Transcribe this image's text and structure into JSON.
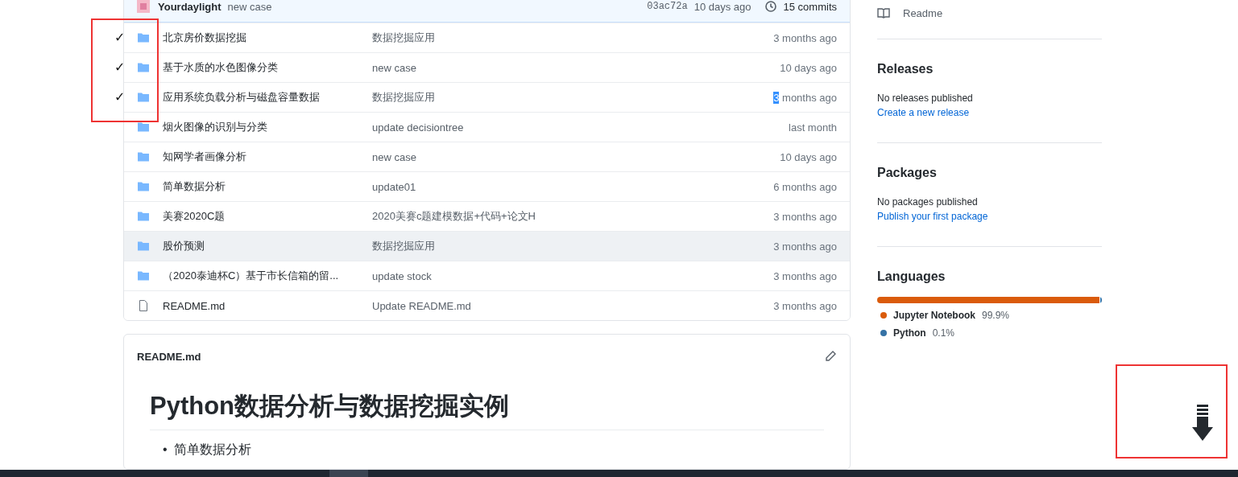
{
  "commit_bar": {
    "author": "Yourdaylight",
    "message": "new case",
    "sha": "03ac72a",
    "time": "10 days ago",
    "commits": "15 commits"
  },
  "files": [
    {
      "kind": "folder",
      "name": "北京房价数据挖掘",
      "message": "数据挖掘应用",
      "time": [
        {
          "text": "3 months ago",
          "selected": false
        }
      ],
      "mark": "✓",
      "hovered": false
    },
    {
      "kind": "folder",
      "name": "基于水质的水色图像分类",
      "message": "new case",
      "time": [
        {
          "text": "10 days ago",
          "selected": false
        }
      ],
      "mark": "✓",
      "hovered": false
    },
    {
      "kind": "folder",
      "name": "应用系统负载分析与磁盘容量数据",
      "message": "数据挖掘应用",
      "time": [
        {
          "text": "3",
          "selected": true
        },
        {
          "text": " months ago",
          "selected": false
        }
      ],
      "mark": "✓",
      "hovered": false
    },
    {
      "kind": "folder",
      "name": "烟火图像的识别与分类",
      "message": "update decisiontree",
      "time": [
        {
          "text": "last month",
          "selected": false
        }
      ],
      "hovered": false
    },
    {
      "kind": "folder",
      "name": "知网学者画像分析",
      "message": "new case",
      "time": [
        {
          "text": "10 days ago",
          "selected": false
        }
      ],
      "hovered": false
    },
    {
      "kind": "folder",
      "name": "简单数据分析",
      "message": "update01",
      "time": [
        {
          "text": "6 months ago",
          "selected": false
        }
      ],
      "hovered": false
    },
    {
      "kind": "folder",
      "name": "美赛2020C题",
      "message": "2020美赛c题建模数据+代码+论文H",
      "time": [
        {
          "text": "3 months ago",
          "selected": false
        }
      ],
      "hovered": false
    },
    {
      "kind": "folder",
      "name": "股价预测",
      "message": "数据挖掘应用",
      "time": [
        {
          "text": "3 months ago",
          "selected": false
        }
      ],
      "hovered": true
    },
    {
      "kind": "folder",
      "name": "（2020泰迪杯C）基于市长信箱的留...",
      "message": "update stock",
      "time": [
        {
          "text": "3 months ago",
          "selected": false
        }
      ],
      "hovered": false
    },
    {
      "kind": "file",
      "name": "README.md",
      "message": "Update README.md",
      "time": [
        {
          "text": "3 months ago",
          "selected": false
        }
      ],
      "hovered": false
    }
  ],
  "readme": {
    "filename": "README.md",
    "heading": "Python数据分析与数据挖掘实例",
    "items": [
      {
        "marker": "•",
        "text": "简单数据分析"
      }
    ]
  },
  "sidebar": {
    "readme_link": "Readme",
    "releases": {
      "title": "Releases",
      "note": "No releases published",
      "link": "Create a new release"
    },
    "packages": {
      "title": "Packages",
      "note": "No packages published",
      "link": "Publish your first package"
    },
    "languages": {
      "title": "Languages",
      "items": [
        {
          "name": "Jupyter Notebook",
          "percent": "99.9%",
          "color": "#da5b0b",
          "level": 0.999
        },
        {
          "name": "Python",
          "percent": "0.1%",
          "color": "#3572a5",
          "level": 0.001
        }
      ]
    }
  }
}
